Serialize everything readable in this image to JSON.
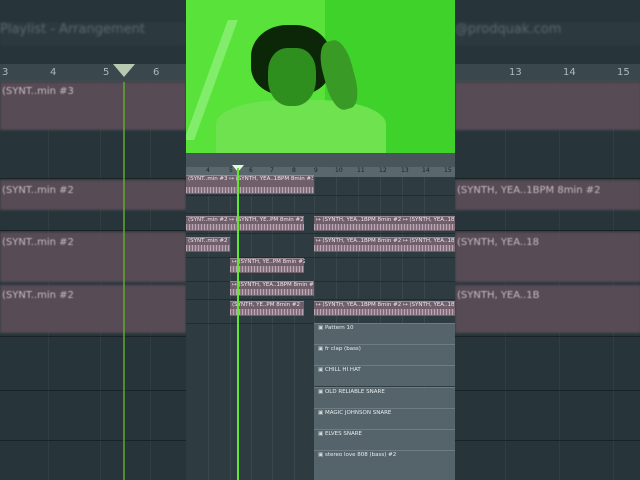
{
  "background": {
    "title_left": "Playlist - Arrangement",
    "title_right": "@prodquak.com",
    "ruler_left": [
      "3",
      "4",
      "5",
      "6"
    ],
    "ruler_right": [
      "13",
      "14",
      "15"
    ],
    "labels_left": [
      "(SYNT..min #3",
      "(SYNT..min #2",
      "(SYNT..min #2",
      "(SYNT..min #2"
    ],
    "labels_right": [
      "(SYNTH, YEA..1BPM 8min #2",
      "(SYNTH, YEA..18",
      "(SYNTH, YEA..1B"
    ]
  },
  "daw": {
    "ruler": [
      "4",
      "5",
      "6",
      "7",
      "8",
      "9",
      "10",
      "11",
      "12",
      "13",
      "14",
      "15"
    ],
    "clips": [
      {
        "label": "(SYNT..min #3 ↦ (SYNTH, YEA..1BPM 8min #3"
      },
      {
        "label": "(SYNT..min #2 ↦ (SYNTH, YE..PM 8min #2"
      },
      {
        "label": "↦ (SYNTH, YEA..1BPM 8min #2 ↦ (SYNTH, YEA..1B"
      },
      {
        "label": "(SYNT..min #2"
      },
      {
        "label": "↦ (SYNTH, YEA..1BPM 8min #2 ↦ (SYNTH, YEA..1B"
      },
      {
        "label": "↦ (SYNTH, YE..PM 8min #2"
      },
      {
        "label": "↦ (SYNTH, YEA..1BPM 8min #2"
      },
      {
        "label": "(SYNTH, YE..PM 8min #2"
      },
      {
        "label": "↦ (SYNTH, YEA..1BPM 8min #2 ↦ (SYNTH, YEA..1B"
      }
    ],
    "patterns": [
      {
        "label": "Pattern 10"
      },
      {
        "label": "fr clap (bass)"
      },
      {
        "label": "CHILL HI HAT"
      },
      {
        "label": "OLD RELIABLE SNARE"
      },
      {
        "label": "MAGIC JOHNSON SNARE"
      },
      {
        "label": "ELVES SNARE"
      },
      {
        "label": "stereo love 808 (bass) #2"
      }
    ]
  },
  "colors": {
    "playhead": "#63e62e",
    "clip": "#6f5f6a",
    "pattern": "#55646a",
    "webcam": "#58e23a"
  }
}
